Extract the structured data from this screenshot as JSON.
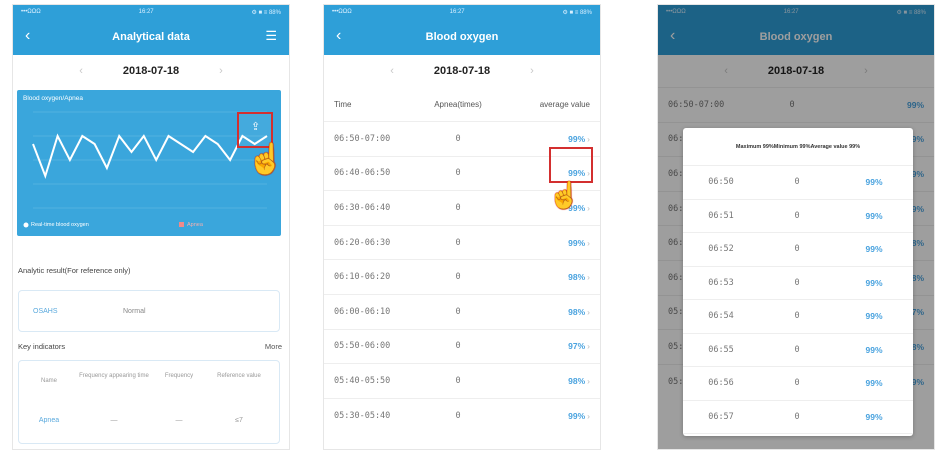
{
  "status": {
    "carrier": "•••ΩΩΩ",
    "time": "16:27",
    "battery": "⚙ ■ ≡ 88%"
  },
  "screen1": {
    "title": "Analytical data",
    "date": "2018-07-18",
    "chart_title": "Blood oxygen/Apnea",
    "chart_data": {
      "type": "line",
      "series": [
        {
          "values": [
            96,
            92,
            97,
            94,
            97,
            96,
            93,
            97,
            95,
            97,
            94,
            97,
            96,
            95,
            97,
            96,
            94,
            97,
            96,
            97
          ]
        }
      ]
    },
    "legend_a": "Real-time blood oxygen",
    "legend_b": "Apnea",
    "analytic_label": "Analytic result(For reference only)",
    "osahs_key": "OSAHS",
    "osahs_val": "Normal",
    "key_indicators": "Key indicators",
    "more": "More",
    "col_name": "Name",
    "col_freq_time": "Frequency appearing time",
    "col_freq": "Frequency",
    "col_ref": "Reference value",
    "row_name": "Apnea",
    "row_ft": "—",
    "row_f": "—",
    "row_ref": "≤7"
  },
  "screen2": {
    "title": "Blood oxygen",
    "date": "2018-07-18",
    "h_time": "Time",
    "h_apnea": "Apnea(times)",
    "h_avg": "average value",
    "rows": [
      {
        "time": "06:50-07:00",
        "apnea": "0",
        "avg": "99%"
      },
      {
        "time": "06:40-06:50",
        "apnea": "0",
        "avg": "99%"
      },
      {
        "time": "06:30-06:40",
        "apnea": "0",
        "avg": "99%"
      },
      {
        "time": "06:20-06:30",
        "apnea": "0",
        "avg": "99%"
      },
      {
        "time": "06:10-06:20",
        "apnea": "0",
        "avg": "98%"
      },
      {
        "time": "06:00-06:10",
        "apnea": "0",
        "avg": "98%"
      },
      {
        "time": "05:50-06:00",
        "apnea": "0",
        "avg": "97%"
      },
      {
        "time": "05:40-05:50",
        "apnea": "0",
        "avg": "98%"
      },
      {
        "time": "05:30-05:40",
        "apnea": "0",
        "avg": "99%"
      }
    ]
  },
  "screen3": {
    "title": "Blood oxygen",
    "date": "2018-07-18",
    "dialog_header": "Maximum 99%Minimum 99%Average value 99%",
    "rows": [
      {
        "time": "06:50",
        "apnea": "0",
        "val": "99%"
      },
      {
        "time": "06:51",
        "apnea": "0",
        "val": "99%"
      },
      {
        "time": "06:52",
        "apnea": "0",
        "val": "99%"
      },
      {
        "time": "06:53",
        "apnea": "0",
        "val": "99%"
      },
      {
        "time": "06:54",
        "apnea": "0",
        "val": "99%"
      },
      {
        "time": "06:55",
        "apnea": "0",
        "val": "99%"
      },
      {
        "time": "06:56",
        "apnea": "0",
        "val": "99%"
      },
      {
        "time": "06:57",
        "apnea": "0",
        "val": "99%"
      }
    ]
  }
}
